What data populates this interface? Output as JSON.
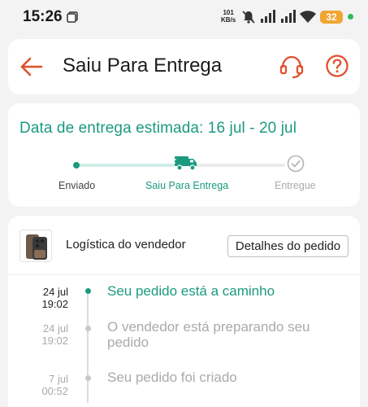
{
  "status_bar": {
    "time": "15:26",
    "network_speed_value": "101",
    "network_speed_unit": "KB/s",
    "battery": "32"
  },
  "header": {
    "title": "Saiu Para Entrega",
    "icons": [
      "back-arrow-icon",
      "headset-support-icon",
      "help-question-icon"
    ],
    "accent_color": "#e0502d"
  },
  "delivery": {
    "estimate_text": "Data de entrega estimada: 16 jul - 20 jul",
    "steps": [
      {
        "label": "Enviado",
        "status": "done"
      },
      {
        "label": "Saiu Para Entrega",
        "status": "current"
      },
      {
        "label": "Entregue",
        "status": "pending"
      }
    ],
    "accent_color": "#1b9a80"
  },
  "order": {
    "seller_label": "Logística do vendedor",
    "details_button": "Detalhes do pedido",
    "timeline": [
      {
        "date": "24 jul",
        "time": "19:02",
        "text": "Seu pedido está a caminho",
        "active": true
      },
      {
        "date": "24 jul",
        "time": "19:02",
        "text": "O vendedor está preparando seu pedido",
        "active": false
      },
      {
        "date": "7 jul",
        "time": "00:52",
        "text": "Seu pedido foi criado",
        "active": false
      }
    ]
  }
}
